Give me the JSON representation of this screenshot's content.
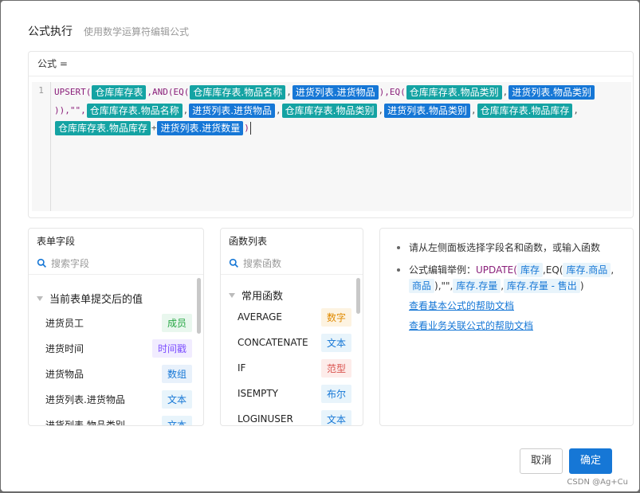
{
  "header": {
    "title": "公式执行",
    "subtitle": "使用数学运算符编辑公式"
  },
  "editor": {
    "label": "公式 =",
    "line_number": "1",
    "formula": [
      {
        "k": "t",
        "v": "UPSERT("
      },
      {
        "k": "tok",
        "c": "t",
        "v": "仓库库存表"
      },
      {
        "k": "t",
        "v": ",AND(EQ("
      },
      {
        "k": "tok",
        "c": "t",
        "v": "仓库库存表.物品名称"
      },
      {
        "k": "p",
        "v": ","
      },
      {
        "k": "tok",
        "c": "b",
        "v": "进货列表.进货物品"
      },
      {
        "k": "t",
        "v": "),EQ("
      },
      {
        "k": "tok",
        "c": "t",
        "v": "仓库库存表.物品类别"
      },
      {
        "k": "p",
        "v": ","
      },
      {
        "k": "tok",
        "c": "b",
        "v": "进货列表.物品类别"
      },
      {
        "k": "t",
        "v": ")),\"\","
      },
      {
        "k": "tok",
        "c": "t",
        "v": "仓库库存表.物品名称"
      },
      {
        "k": "p",
        "v": ","
      },
      {
        "k": "tok",
        "c": "b",
        "v": "进货列表.进货物品"
      },
      {
        "k": "p",
        "v": ","
      },
      {
        "k": "tok",
        "c": "t",
        "v": "仓库库存表.物品类别"
      },
      {
        "k": "p",
        "v": ","
      },
      {
        "k": "tok",
        "c": "b",
        "v": "进货列表.物品类别"
      },
      {
        "k": "p",
        "v": ","
      },
      {
        "k": "tok",
        "c": "t",
        "v": "仓库库存表.物品库存"
      },
      {
        "k": "p",
        "v": ","
      },
      {
        "k": "tok",
        "c": "t",
        "v": "仓库库存表.物品库存"
      },
      {
        "k": "p",
        "v": "+"
      },
      {
        "k": "tok",
        "c": "b",
        "v": "进货列表.进货数量"
      },
      {
        "k": "t",
        "v": ")"
      }
    ]
  },
  "fields_panel": {
    "title": "表单字段",
    "search_placeholder": "搜索字段",
    "group": "当前表单提交后的值",
    "items": [
      {
        "name": "进货员工",
        "type": "成员",
        "color": "#28a745",
        "bg": "#e9f7ee"
      },
      {
        "name": "进货时间",
        "type": "时间戳",
        "color": "#7c4dff",
        "bg": "#f1ecff"
      },
      {
        "name": "进货物品",
        "type": "数组",
        "color": "#1677d6",
        "bg": "#e8f1fb"
      },
      {
        "name": "进货列表.进货物品",
        "type": "文本",
        "color": "#1677d6",
        "bg": "#e8f4fb"
      },
      {
        "name": "进货列表.物品类别",
        "type": "文本",
        "color": "#1677d6",
        "bg": "#e8f4fb"
      }
    ]
  },
  "functions_panel": {
    "title": "函数列表",
    "search_placeholder": "搜索函数",
    "group": "常用函数",
    "items": [
      {
        "name": "AVERAGE",
        "type": "数字",
        "color": "#e08a00",
        "bg": "#fdf3e1"
      },
      {
        "name": "CONCATENATE",
        "type": "文本",
        "color": "#1677d6",
        "bg": "#e8f4fb"
      },
      {
        "name": "IF",
        "type": "范型",
        "color": "#d9534f",
        "bg": "#fdecea"
      },
      {
        "name": "ISEMPTY",
        "type": "布尔",
        "color": "#1677d6",
        "bg": "#e8f4fb"
      },
      {
        "name": "LOGINUSER",
        "type": "文本",
        "color": "#1677d6",
        "bg": "#e8f4fb"
      }
    ]
  },
  "help": {
    "tip1": "请从左侧面板选择字段名和函数，或输入函数",
    "tip2_prefix": "公式编辑举例：",
    "ex_update": "UPDATE(",
    "ex_kucun": "库存",
    "ex_eq": ",EQ(",
    "ex_kucun_shangpin": "库存.商品",
    "ex_comma": ",",
    "ex_shangpin": "商品",
    "ex_mid": "),\"\",",
    "ex_kucun_cunliang": "库存.存量",
    "ex_comma2": ",",
    "ex_kucun_cunliang_minus": "库存.存量 - 售出",
    "ex_end": ")",
    "link1": "查看基本公式的帮助文档",
    "link2": "查看业务关联公式的帮助文档"
  },
  "buttons": {
    "cancel": "取消",
    "ok": "确定"
  },
  "watermark": "CSDN @Ag+Cu"
}
